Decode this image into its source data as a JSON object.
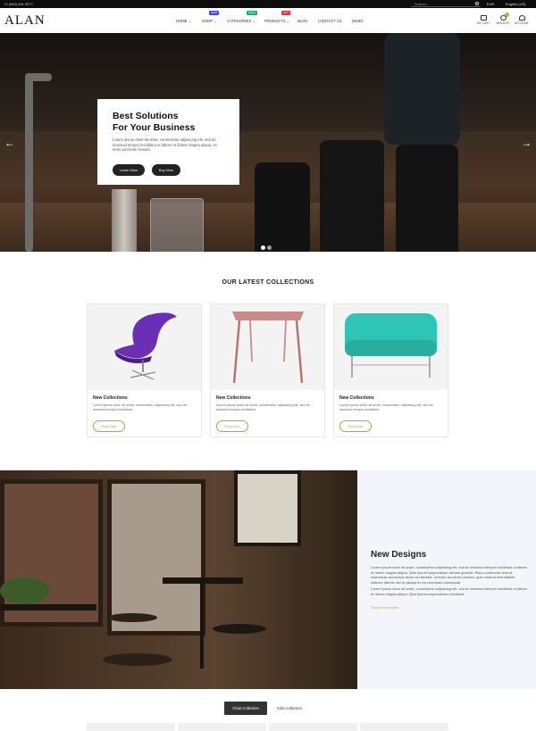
{
  "topbar": {
    "phone": "+1 (940) 491 0277",
    "search_placeholder": "Search...",
    "currency": "EUR",
    "language": "English (US)"
  },
  "header": {
    "logo": "ALAN",
    "nav": [
      {
        "label": "HOME",
        "chevron": true
      },
      {
        "label": "SHOP",
        "chevron": true,
        "badge": "NEW",
        "badge_color": "#3b4be0"
      },
      {
        "label": "CATEGORIES",
        "chevron": true,
        "badge": "SALE",
        "badge_color": "#27ae60"
      },
      {
        "label": "PRODUCTS",
        "chevron": true,
        "badge": "HOT",
        "badge_color": "#e0303b"
      },
      {
        "label": "BLOG",
        "chevron": false
      },
      {
        "label": "CONTACT US",
        "chevron": false
      },
      {
        "label": "DEMO",
        "chevron": false
      }
    ],
    "icons": {
      "cart_label": "MY CART",
      "wishlist_label": "WISHLIST",
      "wishlist_count": "0",
      "account_label": "ACCOUNT"
    }
  },
  "hero": {
    "title_line1": "Best Solutions",
    "title_line2": "For Your Business",
    "text": "Lorem ipsum dolor sit amet, consectetur adipiscing elit, sed do eiusmod tempor incididunt ut labore et dolore magna aliqua. Ut enim ad minim veniam.",
    "learn_more": "Learn More",
    "buy_now": "Buy Now",
    "prev_arrow": "←",
    "next_arrow": "→"
  },
  "collections": {
    "title": "OUR LATEST COLLECTIONS",
    "items": [
      {
        "title": "New Collections",
        "text": "Lorem ipsum dolor sit amet, consectetur adipiscing elit, sed do eiusmod tempor incididunt.",
        "button": "Shop Now"
      },
      {
        "title": "New Collections",
        "text": "Lorem ipsum dolor sit amet, consectetur adipiscing elit, sed do eiusmod tempor incididunt.",
        "button": "Shop Now"
      },
      {
        "title": "New Collections",
        "text": "Lorem ipsum dolor sit amet, consectetur adipiscing elit, sed do eiusmod tempor incididunt.",
        "button": "Shop Now"
      }
    ]
  },
  "new_designs": {
    "title": "New Designs",
    "para1": "Lorem ipsum dolor sit amet, consectetur adipiscing elit, sed do eiusmod tempor incididunt ut labore et dolore magna aliqua. Quis ipsum suspendisse ultrices gravida. Risus commodo viverra maecenas accumsan lacus vel facilisis. Ut enim ad minim veniam, quis nostrud exercitation ullamco laboris nisi ut aliquip ex ea commodo consequat.",
    "para2": "Lorem ipsum dolor sit amet, consectetur adipiscing elit, sed do eiusmod tempor incididunt ut labore et dolore magna aliqua. Quis ipsum suspendisse incididunt.",
    "link": "Explo the product"
  },
  "tabs": {
    "chair": "Chair Collection",
    "sofa": "Sofa Collection"
  },
  "colors": {
    "accent": "#c59a4a",
    "dark": "#222222",
    "panel_bg": "#f4f4fb"
  }
}
